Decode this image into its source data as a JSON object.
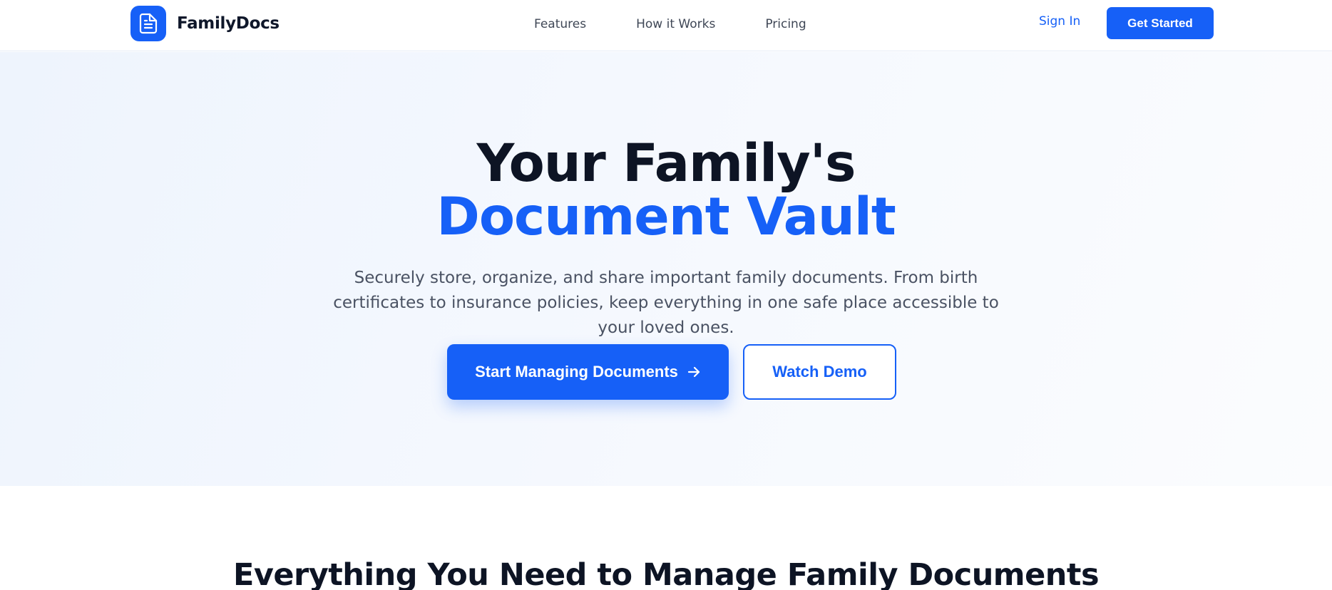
{
  "brand": {
    "name": "FamilyDocs",
    "logo_icon": "document-icon",
    "accent_color": "#1660f7"
  },
  "nav": {
    "links": [
      "Features",
      "How it Works",
      "Pricing"
    ],
    "sign_in": "Sign In",
    "get_started": "Get Started"
  },
  "hero": {
    "title_line1": "Your Family's",
    "title_line2": "Document Vault",
    "subtitle": "Securely store, organize, and share important family documents. From birth certificates to insurance policies, keep everything in one safe place accessible to your loved ones.",
    "primary_cta": "Start Managing Documents",
    "primary_cta_icon": "arrow-right-icon",
    "secondary_cta": "Watch Demo"
  },
  "features": {
    "heading": "Everything You Need to Manage Family Documents"
  }
}
